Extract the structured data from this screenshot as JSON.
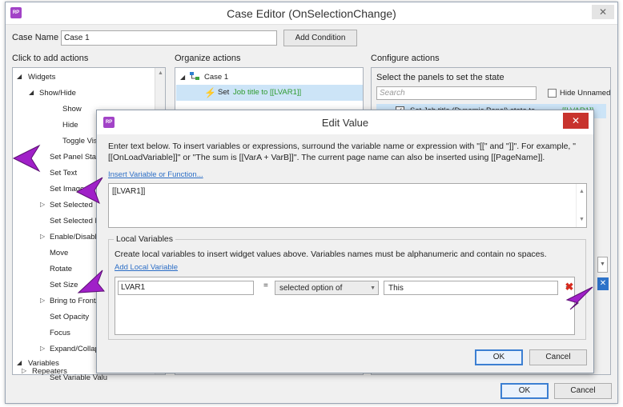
{
  "app_icon": "RP",
  "window": {
    "title": "Case Editor (OnSelectionChange)",
    "close_glyph": "✕"
  },
  "case_name": {
    "label": "Case Name",
    "value": "Case 1"
  },
  "add_condition_label": "Add Condition",
  "left_panel": {
    "heading": "Click to add actions",
    "items": [
      "Widgets",
      "Show/Hide",
      "Show",
      "Hide",
      "Toggle Visib",
      "Set Panel State",
      "Set Text",
      "Set Image",
      "Set Selected",
      "Set Selected Li",
      "Enable/Disable",
      "Move",
      "Rotate",
      "Set Size",
      "Bring to Front/B",
      "Set Opacity",
      "Focus",
      "Expand/Collapse",
      "Variables",
      "Set Variable Valu",
      "Repeaters"
    ]
  },
  "middle_panel": {
    "heading": "Organize actions",
    "case_label": "Case 1",
    "action": {
      "prefix": "Set",
      "text": "Job title to [[LVAR1]]"
    }
  },
  "right_panel": {
    "heading": "Configure actions",
    "subheading": "Select the panels to set the state",
    "search_placeholder": "Search",
    "hide_unnamed": "Hide Unnamed",
    "panel_item": {
      "label": "Set Job title (Dynamic Panel) state to",
      "value": "[[LVAR1]]"
    }
  },
  "footer": {
    "ok": "OK",
    "cancel": "Cancel"
  },
  "dialog": {
    "icon": "RP",
    "title": "Edit Value",
    "close_glyph": "✕",
    "instructions": "Enter text below. To insert variables or expressions, surround the variable name or expression with \"[[\" and \"]]\". For example, \"[[OnLoadVariable]]\" or \"The sum is [[VarA + VarB]]\". The current page name can also be inserted using [[PageName]].",
    "insert_link": "Insert Variable or Function...",
    "text_value": "[[LVAR1]]",
    "local_vars": {
      "legend": "Local Variables",
      "desc": "Create local variables to insert widget values above. Variables names must be alphanumeric and contain no spaces.",
      "add_link": "Add Local Variable",
      "row": {
        "name": "LVAR1",
        "equals": "=",
        "type": "selected option of",
        "target": "This"
      }
    },
    "ok": "OK",
    "cancel": "Cancel"
  },
  "colors": {
    "accent": "#a243c7",
    "close_red": "#c8332d",
    "link": "#2c6ec6",
    "green_text": "#2f9a2f"
  }
}
